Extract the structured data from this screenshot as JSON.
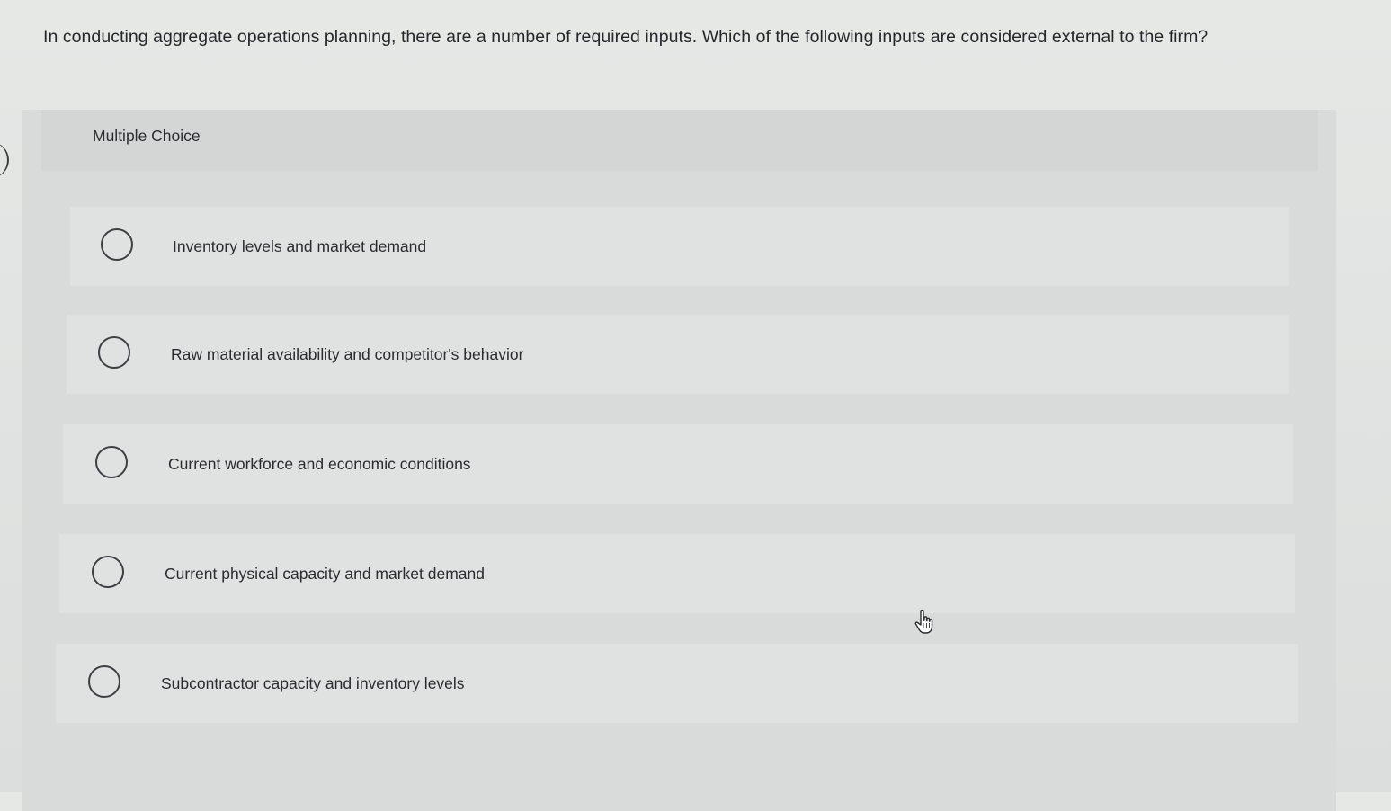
{
  "question": {
    "text": "In conducting aggregate operations planning, there are a number of required inputs. Which of the following inputs are considered external to the firm?"
  },
  "panel": {
    "header_label": "Multiple Choice"
  },
  "options": [
    {
      "label": "Inventory levels and market demand",
      "selected": false
    },
    {
      "label": "Raw material availability and competitor's behavior",
      "selected": false
    },
    {
      "label": "Current workforce and economic conditions",
      "selected": false
    },
    {
      "label": "Current physical capacity and market demand",
      "selected": false
    },
    {
      "label": "Subcontractor capacity and inventory levels",
      "selected": false
    }
  ],
  "icons": {
    "cursor": "hand-pointer-icon",
    "radio": "radio-button-icon"
  },
  "colors": {
    "background": "#e3e5e4",
    "panel": "#d9dbda",
    "option_row": "#e0e2e1",
    "text": "#2a2c30"
  }
}
